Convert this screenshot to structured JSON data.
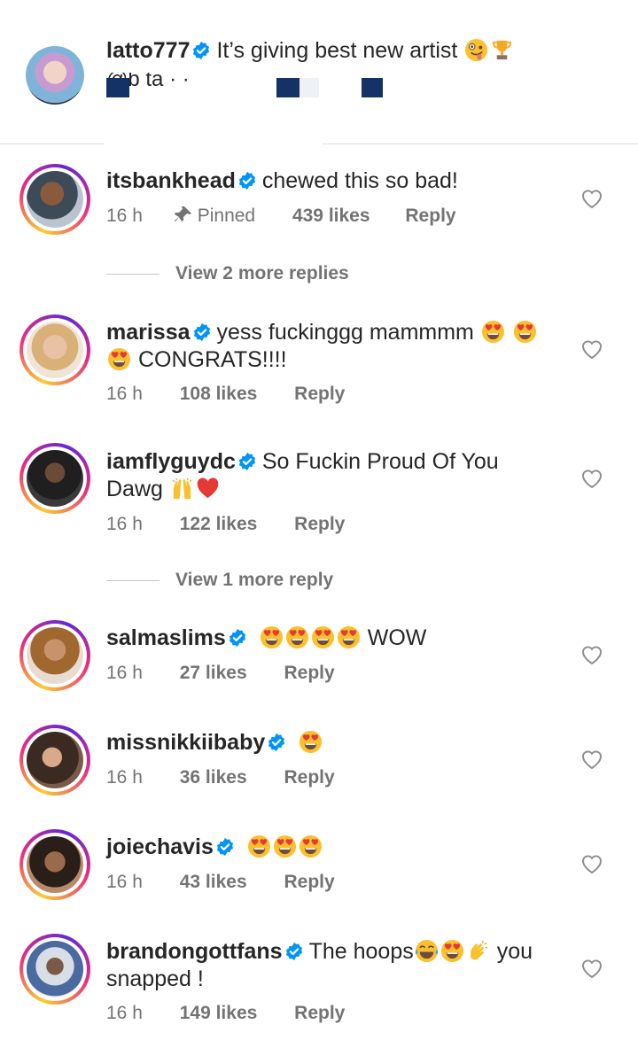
{
  "post": {
    "username": "latto777",
    "caption": "It’s giving best new artist",
    "mention_partial": "@b  ta  ·  ·",
    "emojis": [
      "zany-face",
      "trophy"
    ]
  },
  "comments": [
    {
      "username": "itsbankhead",
      "text": "chewed this so bad!",
      "time": "16 h",
      "pinned_label": "Pinned",
      "likes": "439 likes",
      "reply": "Reply",
      "view_replies": "View 2 more replies"
    },
    {
      "username": "marissa",
      "text_before": "yess fuckinggg mammmm",
      "text_after": "CONGRATS!!!!",
      "time": "16 h",
      "likes": "108 likes",
      "reply": "Reply"
    },
    {
      "username": "iamflyguydc",
      "text_before": "So Fuckin Proud Of You Dawg",
      "time": "16 h",
      "likes": "122 likes",
      "reply": "Reply",
      "view_replies": "View 1 more reply"
    },
    {
      "username": "salmaslims",
      "text_after": "WOW",
      "time": "16 h",
      "likes": "27 likes",
      "reply": "Reply"
    },
    {
      "username": "missnikkiibaby",
      "time": "16 h",
      "likes": "36 likes",
      "reply": "Reply"
    },
    {
      "username": "joiechavis",
      "time": "16 h",
      "likes": "43 likes",
      "reply": "Reply"
    },
    {
      "username": "brandongottfans",
      "text_before": "The hoops",
      "text_after": "you snapped !",
      "time": "16 h",
      "likes": "149 likes",
      "reply": "Reply"
    }
  ],
  "icons": {
    "verified": "verified-badge-icon",
    "heart": "heart-outline-icon",
    "pin": "pin-icon"
  },
  "colors": {
    "verified_blue": "#0095f6",
    "text": "#262626",
    "secondary": "#737373"
  }
}
